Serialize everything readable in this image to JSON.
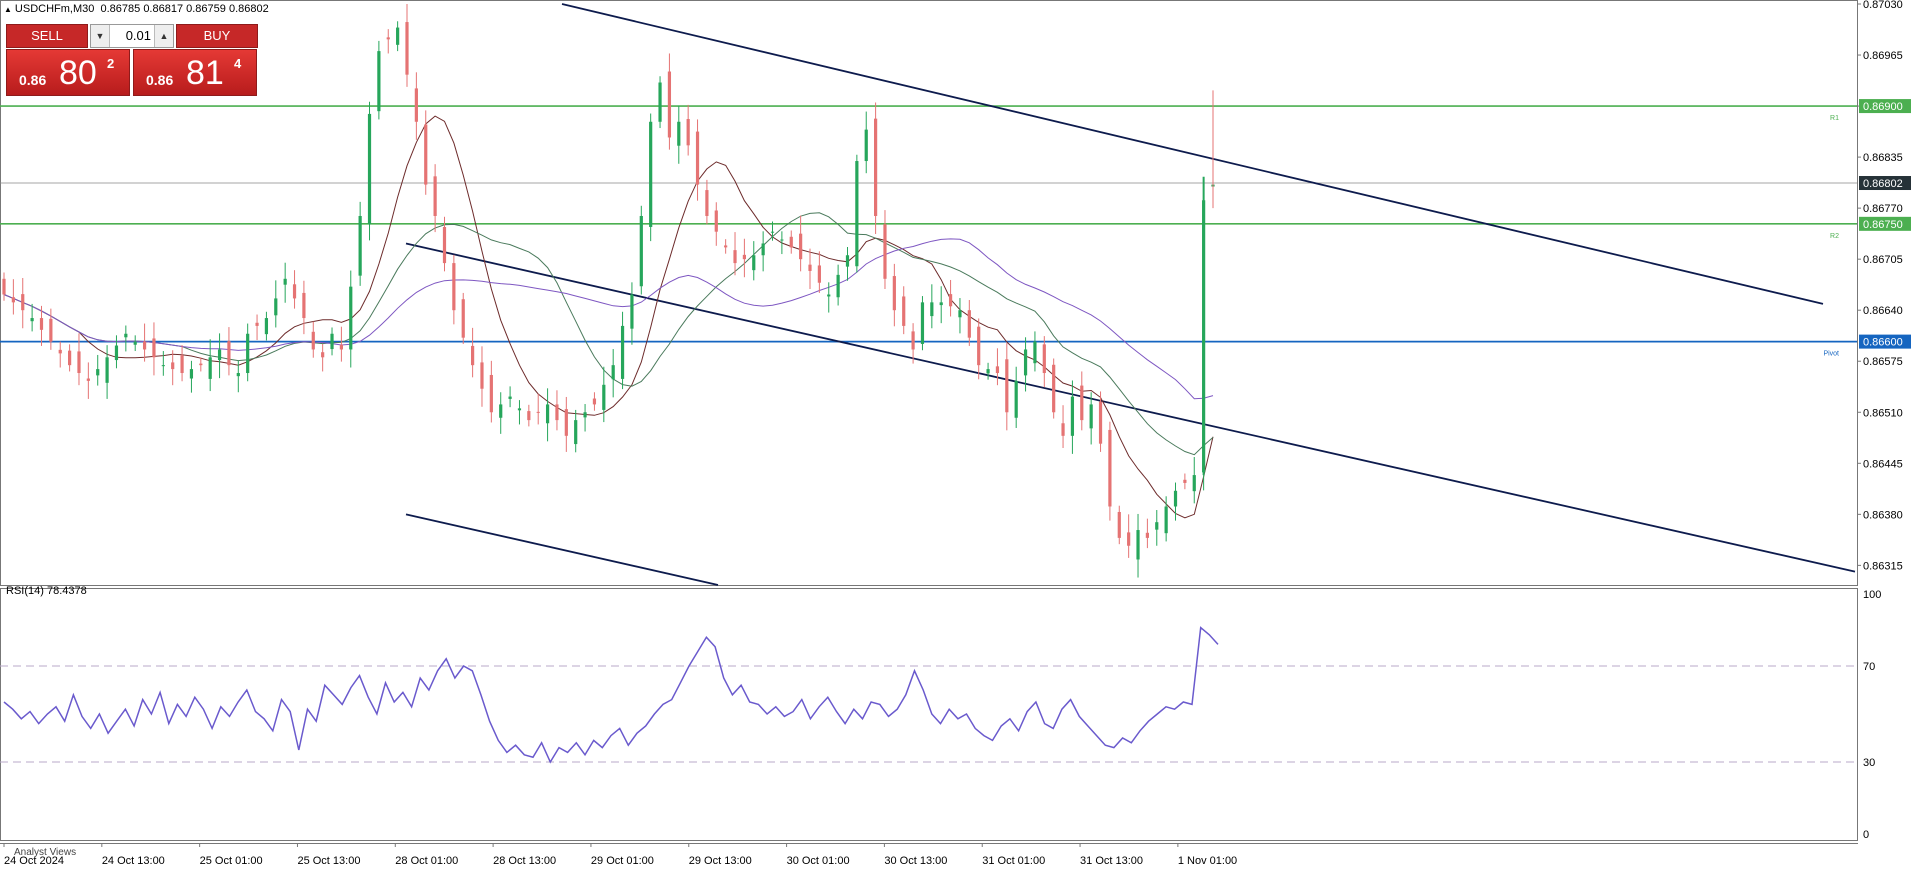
{
  "header": {
    "symbol": "USDCHFm,M30",
    "ohlc": "0.86785 0.86817 0.86759 0.86802"
  },
  "trade_panel": {
    "sell_label": "SELL",
    "buy_label": "BUY",
    "lot": "0.01",
    "sell_small": "0.86",
    "sell_big": "80",
    "sell_sup": "2",
    "buy_small": "0.86",
    "buy_big": "81",
    "buy_sup": "4"
  },
  "chart_data": [
    {
      "type": "candlestick",
      "title": "USDCHFm,M30",
      "ylim": [
        0.8629,
        0.8703
      ],
      "y_ticks": [
        "0.87030",
        "0.86965",
        "0.86900",
        "0.86835",
        "0.86770",
        "0.86705",
        "0.86640",
        "0.86575",
        "0.86510",
        "0.86445",
        "0.86380",
        "0.86315"
      ],
      "x_ticks": [
        "24 Oct 2024",
        "24 Oct 13:00",
        "25 Oct 01:00",
        "25 Oct 13:00",
        "28 Oct 01:00",
        "28 Oct 13:00",
        "29 Oct 01:00",
        "29 Oct 13:00",
        "30 Oct 01:00",
        "30 Oct 13:00",
        "31 Oct 01:00",
        "31 Oct 13:00",
        "1 Nov 01:00"
      ],
      "close_path": [
        [
          0,
          0.8666
        ],
        [
          3,
          0.8663
        ],
        [
          5,
          0.866
        ],
        [
          7,
          0.8657
        ],
        [
          9,
          0.8655
        ],
        [
          11,
          0.8658
        ],
        [
          13,
          0.8661
        ],
        [
          15,
          0.8659
        ],
        [
          17,
          0.8657
        ],
        [
          19,
          0.8656
        ],
        [
          21,
          0.8657
        ],
        [
          23,
          0.8659
        ],
        [
          24,
          0.8657
        ],
        [
          25,
          0.8656
        ],
        [
          26,
          0.8661
        ],
        [
          28,
          0.8663
        ],
        [
          30,
          0.8668
        ],
        [
          32,
          0.8663
        ],
        [
          33,
          0.8659
        ],
        [
          34,
          0.8658
        ],
        [
          35,
          0.8661
        ],
        [
          36,
          0.8659
        ],
        [
          37,
          0.8667
        ],
        [
          38,
          0.8676
        ],
        [
          39,
          0.8689
        ],
        [
          40,
          0.8697
        ],
        [
          42,
          0.87
        ],
        [
          43,
          0.8694
        ],
        [
          44,
          0.8688
        ],
        [
          45,
          0.868
        ],
        [
          46,
          0.8676
        ],
        [
          47,
          0.867
        ],
        [
          48,
          0.8664
        ],
        [
          50,
          0.8657
        ],
        [
          52,
          0.8651
        ],
        [
          54,
          0.8653
        ],
        [
          56,
          0.865
        ],
        [
          58,
          0.8652
        ],
        [
          60,
          0.8648
        ],
        [
          61,
          0.865
        ],
        [
          63,
          0.8652
        ],
        [
          65,
          0.8657
        ],
        [
          66,
          0.8662
        ],
        [
          67,
          0.8666
        ],
        [
          68,
          0.8676
        ],
        [
          69,
          0.8688
        ],
        [
          70,
          0.8693
        ],
        [
          71,
          0.8686
        ],
        [
          72,
          0.8688
        ],
        [
          73,
          0.8685
        ],
        [
          74,
          0.868
        ],
        [
          75,
          0.8676
        ],
        [
          76,
          0.8674
        ],
        [
          77,
          0.8672
        ],
        [
          78,
          0.867
        ],
        [
          80,
          0.8671
        ],
        [
          82,
          0.8674
        ],
        [
          84,
          0.8672
        ],
        [
          86,
          0.8669
        ],
        [
          88,
          0.8666
        ],
        [
          90,
          0.8671
        ],
        [
          91,
          0.8683
        ],
        [
          92,
          0.8687
        ],
        [
          93,
          0.8676
        ],
        [
          94,
          0.8668
        ],
        [
          95,
          0.8664
        ],
        [
          96,
          0.8662
        ],
        [
          97,
          0.8659
        ],
        [
          98,
          0.8665
        ],
        [
          100,
          0.8665
        ],
        [
          102,
          0.8664
        ],
        [
          104,
          0.8657
        ],
        [
          106,
          0.8656
        ],
        [
          107,
          0.8651
        ],
        [
          108,
          0.8655
        ],
        [
          109,
          0.8659
        ],
        [
          110,
          0.866
        ],
        [
          111,
          0.8656
        ],
        [
          112,
          0.8651
        ],
        [
          113,
          0.8648
        ],
        [
          114,
          0.8653
        ],
        [
          115,
          0.865
        ],
        [
          116,
          0.8652
        ],
        [
          117,
          0.8647
        ],
        [
          118,
          0.8639
        ],
        [
          119,
          0.8635
        ],
        [
          120,
          0.8634
        ],
        [
          121,
          0.8636
        ],
        [
          122,
          0.8635
        ],
        [
          123,
          0.8637
        ],
        [
          124,
          0.8639
        ],
        [
          125,
          0.8641
        ],
        [
          126,
          0.8642
        ],
        [
          127,
          0.8643
        ],
        [
          128,
          0.8678
        ],
        [
          129,
          0.868
        ]
      ],
      "last_price": "0.86802",
      "levels": [
        {
          "name": "R1",
          "price": "0.86900",
          "color": "#4caf50"
        },
        {
          "name": "R2",
          "price": "0.86750",
          "color": "#4caf50"
        },
        {
          "name": "Pivot",
          "price": "0.86600",
          "color": "#1565c0"
        }
      ],
      "price_label_last": "0.86802",
      "price_label_r1": "0.86900",
      "price_label_r2": "0.86750",
      "price_label_pivot": "0.86600",
      "r1_tag": "R1",
      "r2_tag": "R2",
      "pivot_tag": "Pivot",
      "colors": {
        "up": "#26a65b",
        "down": "#e57373",
        "trendline": "#0d1b4d",
        "ma1": "#6d2b2b",
        "ma2": "#7e57c2",
        "ma3": "#4a7a5c"
      }
    },
    {
      "type": "line",
      "title": "RSI(14) 78.4378",
      "ylim": [
        0,
        100
      ],
      "y_ticks": [
        "100",
        "70",
        "30",
        "0"
      ],
      "levels": [
        70,
        30
      ],
      "last_value": 78.4378,
      "color": "#6a5acd",
      "values": [
        55,
        52,
        48,
        51,
        46,
        50,
        53,
        47,
        58,
        49,
        44,
        50,
        42,
        47,
        52,
        45,
        56,
        50,
        59,
        46,
        54,
        49,
        57,
        52,
        44,
        53,
        49,
        55,
        60,
        51,
        48,
        43,
        56,
        51,
        35,
        52,
        47,
        62,
        58,
        54,
        61,
        66,
        57,
        50,
        63,
        55,
        59,
        53,
        65,
        60,
        68,
        73,
        65,
        70,
        68,
        58,
        47,
        39,
        34,
        37,
        33,
        32,
        38,
        30,
        36,
        34,
        38,
        33,
        39,
        36,
        41,
        44,
        37,
        42,
        45,
        50,
        54,
        56,
        63,
        70,
        76,
        82,
        78,
        65,
        58,
        62,
        55,
        54,
        50,
        53,
        49,
        51,
        56,
        48,
        53,
        57,
        51,
        46,
        52,
        48,
        55,
        54,
        49,
        52,
        58,
        68,
        60,
        50,
        46,
        52,
        48,
        50,
        44,
        41,
        39,
        45,
        48,
        43,
        51,
        55,
        46,
        44,
        52,
        56,
        49,
        45,
        41,
        37,
        36,
        40,
        38,
        43,
        47,
        50,
        53,
        52,
        55,
        54,
        86,
        83,
        79
      ]
    }
  ],
  "bottom": {
    "analyst_views": "Analyst Views"
  }
}
